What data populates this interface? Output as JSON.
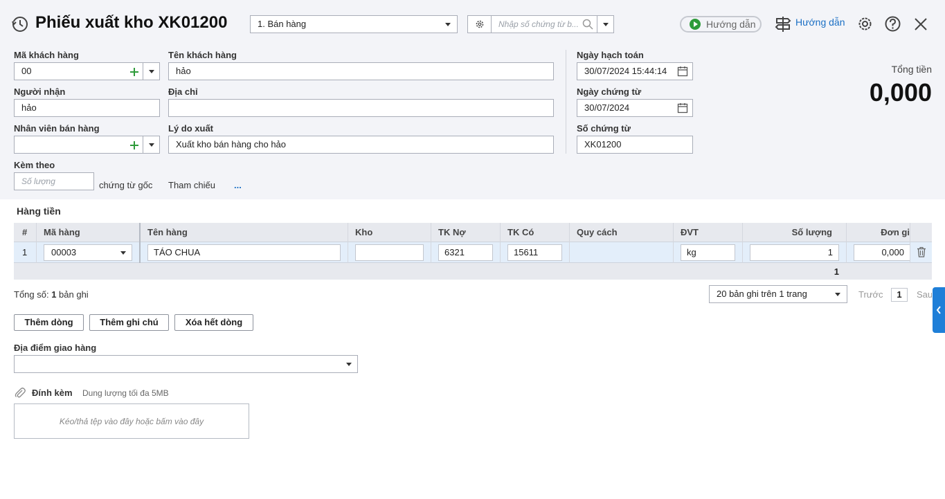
{
  "header": {
    "title": "Phiếu xuất kho XK01200",
    "type_select": "1. Bán hàng",
    "search_placeholder": "Nhập số chứng từ b...",
    "guide_pill": "Hướng dẫn",
    "guide_link": "Hướng dẫn"
  },
  "form": {
    "ma_kh_label": "Mã khách hàng",
    "ma_kh_value": "00",
    "ten_kh_label": "Tên khách hàng",
    "ten_kh_value": "hảo",
    "nguoi_nhan_label": "Người nhận",
    "nguoi_nhan_value": "hảo",
    "dia_chi_label": "Địa chỉ",
    "dia_chi_value": "",
    "nvbh_label": "Nhân viên bán hàng",
    "nvbh_value": "",
    "ly_do_label": "Lý do xuất",
    "ly_do_value": "Xuất kho bán hàng cho hảo",
    "kem_theo_label": "Kèm theo",
    "so_luong_placeholder": "Số lượng",
    "chung_tu_goc": "chứng từ gốc",
    "tham_chieu": "Tham chiếu",
    "ellipsis": "...",
    "ngay_ht_label": "Ngày hạch toán",
    "ngay_ht_value": "30/07/2024 15:44:14",
    "ngay_ct_label": "Ngày chứng từ",
    "ngay_ct_value": "30/07/2024",
    "so_ct_label": "Số chứng từ",
    "so_ct_value": "XK01200",
    "tong_tien_label": "Tổng tiền",
    "tong_tien_value": "0,000"
  },
  "grid": {
    "section_title": "Hàng tiền",
    "columns": [
      "#",
      "Mã hàng",
      "Tên hàng",
      "Kho",
      "TK Nợ",
      "TK Có",
      "Quy cách",
      "ĐVT",
      "Số lượng",
      "Đơn gi"
    ],
    "rows": [
      {
        "no": "1",
        "ma_hang": "00003",
        "ten_hang": "TÁO CHUA",
        "kho": "",
        "tk_no": "6321",
        "tk_co": "15611",
        "quy_cach": "",
        "dvt": "kg",
        "so_luong": "1",
        "don_gia": "0,000"
      }
    ],
    "total_qty": "1"
  },
  "pagination": {
    "total_prefix": "Tổng số: ",
    "total_count": "1",
    "total_suffix": " bản ghi",
    "page_size": "20 bản ghi trên 1 trang",
    "prev": "Trước",
    "page": "1",
    "next": "Sau"
  },
  "actions": {
    "add_row": "Thêm dòng",
    "add_note": "Thêm ghi chú",
    "delete_all": "Xóa hết dòng"
  },
  "delivery": {
    "label": "Địa điểm giao hàng",
    "value": ""
  },
  "attach": {
    "label": "Đính kèm",
    "hint": "Dung lượng tối đa 5MB",
    "drop_text": "Kéo/thả tệp vào đây hoặc bấm vào đây"
  },
  "colors": {
    "accent": "#1a6fc4",
    "green": "#2e9b3a",
    "grid_header": "#e7e9ee",
    "selected_row": "#e3eefa"
  }
}
